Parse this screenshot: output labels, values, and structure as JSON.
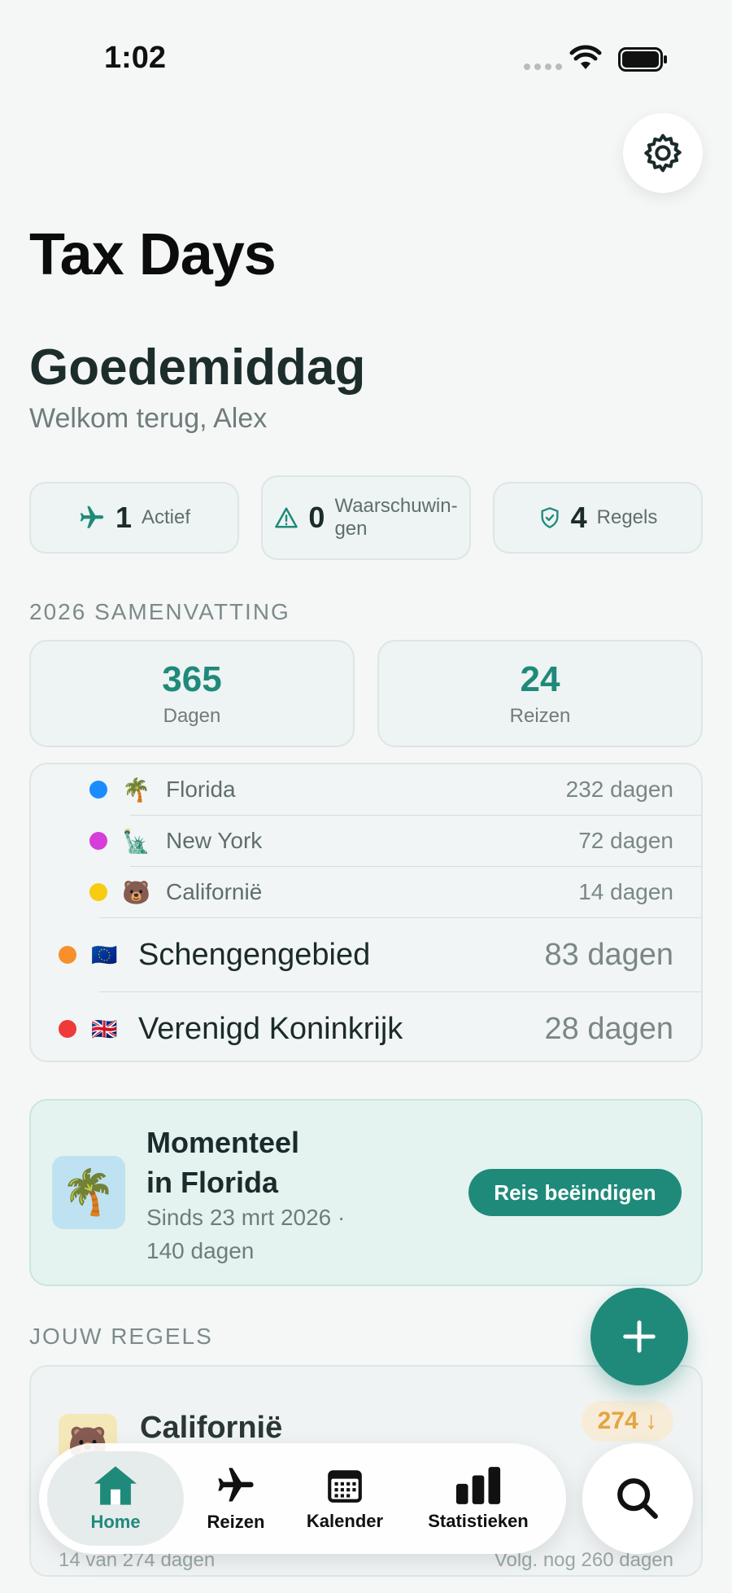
{
  "status_bar": {
    "time": "1:02"
  },
  "app": {
    "title": "Tax Days"
  },
  "greeting": {
    "title": "Goedemiddag",
    "subtitle": "Welkom terug, Alex"
  },
  "chips": [
    {
      "icon": "plane-icon",
      "count": "1",
      "label": "Actief"
    },
    {
      "icon": "warning-icon",
      "count": "0",
      "label": "Waarschuwin-\ngen"
    },
    {
      "icon": "shield-icon",
      "count": "4",
      "label": "Regels"
    }
  ],
  "summary": {
    "section_label": "2026 SAMENVATTING",
    "days_value": "365",
    "days_label": "Dagen",
    "trips_value": "24",
    "trips_label": "Reizen"
  },
  "regions": [
    {
      "name": "Florida",
      "flag": "🌴",
      "days": "232 dagen",
      "color": "#1a8cff",
      "level": "sub"
    },
    {
      "name": "New York",
      "flag": "🗽",
      "days": "72 dagen",
      "color": "#d53ed8",
      "level": "sub"
    },
    {
      "name": "Californië",
      "flag": "🐻",
      "days": "14 dagen",
      "color": "#f7cc12",
      "level": "sub"
    },
    {
      "name": "Schengengebied",
      "flag": "🇪🇺",
      "days": "83 dagen",
      "color": "#f7902a",
      "level": "main"
    },
    {
      "name": "Verenigd Koninkrijk",
      "flag": "🇬🇧",
      "days": "28 dagen",
      "color": "#f03a3a",
      "level": "main"
    }
  ],
  "current": {
    "icon": "🌴",
    "title": "Momenteel\nin Florida",
    "subtitle": "Sinds 23 mrt 2026 ·\n140 dagen",
    "button": "Reis beëindigen"
  },
  "rules": {
    "section_label": "JOUW REGELS",
    "first": {
      "icon": "🐻",
      "name": "Californië",
      "badge": "274 ↓",
      "footer_left": "14 van 274 dagen",
      "footer_right": "Volg. nog 260 dagen"
    }
  },
  "tabs": [
    {
      "label": "Home",
      "icon": "house-icon",
      "active": true
    },
    {
      "label": "Reizen",
      "icon": "airplane-icon",
      "active": false
    },
    {
      "label": "Kalender",
      "icon": "calendar-icon",
      "active": false
    },
    {
      "label": "Statistieken",
      "icon": "bar-chart-icon",
      "active": false
    }
  ],
  "colors": {
    "accent": "#1f8a7a",
    "warning": "#e5a440"
  }
}
